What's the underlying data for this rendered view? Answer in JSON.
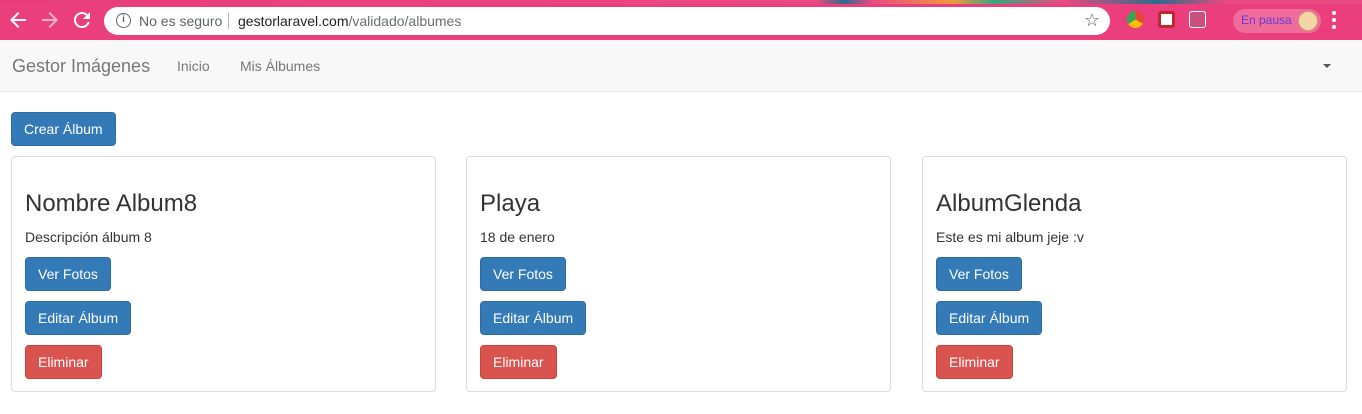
{
  "browser": {
    "security_label": "No es seguro",
    "url_host": "gestorlaravel.com",
    "url_path": "/validado/albumes",
    "profile_label": "En pausa",
    "accent_color": "#ea3f7c"
  },
  "navbar": {
    "brand": "Gestor Imágenes",
    "links": [
      "Inicio",
      "Mis Álbumes"
    ]
  },
  "actions": {
    "create_label": "Crear Álbum"
  },
  "albums": [
    {
      "title": "Nombre Album8",
      "description": "Descripción álbum 8",
      "view_label": "Ver Fotos",
      "edit_label": "Editar Álbum",
      "delete_label": "Eliminar"
    },
    {
      "title": "Playa",
      "description": "18 de enero",
      "view_label": "Ver Fotos",
      "edit_label": "Editar Álbum",
      "delete_label": "Eliminar"
    },
    {
      "title": "AlbumGlenda",
      "description": "Este es mi album jeje :v",
      "view_label": "Ver Fotos",
      "edit_label": "Editar Álbum",
      "delete_label": "Eliminar"
    }
  ]
}
